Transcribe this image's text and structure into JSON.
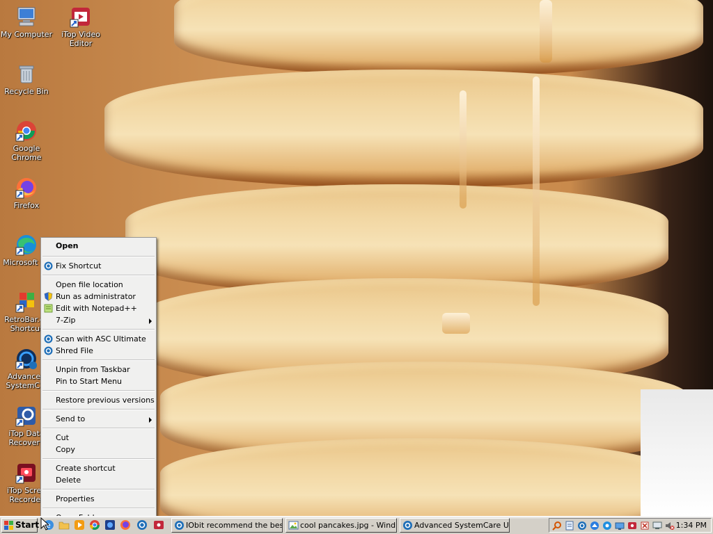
{
  "desktop": {
    "icons": [
      {
        "label": "My Computer"
      },
      {
        "label": "iTop Video Editor"
      },
      {
        "label": "Recycle Bin"
      },
      {
        "label": "Google Chrome"
      },
      {
        "label": "Firefox"
      },
      {
        "label": "Microsoft Ed"
      },
      {
        "label": "RetroBar.ex Shortcut"
      },
      {
        "label": "Advanced SystemC..."
      },
      {
        "label": "iTop Data Recovery"
      },
      {
        "label": "iTop Scree Recorder"
      }
    ]
  },
  "context_menu": {
    "items": [
      {
        "label": "Open"
      },
      {
        "label": "Fix Shortcut"
      },
      {
        "label": "Open file location"
      },
      {
        "label": "Run as administrator"
      },
      {
        "label": "Edit with Notepad++"
      },
      {
        "label": "7-Zip"
      },
      {
        "label": "Scan with ASC Ultimate"
      },
      {
        "label": "Shred File"
      },
      {
        "label": "Unpin from Taskbar"
      },
      {
        "label": "Pin to Start Menu"
      },
      {
        "label": "Restore previous versions"
      },
      {
        "label": "Send to"
      },
      {
        "label": "Cut"
      },
      {
        "label": "Copy"
      },
      {
        "label": "Create shortcut"
      },
      {
        "label": "Delete"
      },
      {
        "label": "Properties"
      },
      {
        "label": "Open Folder"
      }
    ]
  },
  "taskbar": {
    "start_label": "Start",
    "windows": [
      {
        "label": "IObit recommend the bes..."
      },
      {
        "label": "cool pancakes.jpg - Wind..."
      },
      {
        "label": "Advanced SystemCare Ul..."
      }
    ],
    "clock": "1:34 PM"
  },
  "colors": {
    "taskbar": "#d4d0c8",
    "menu_bg": "#f0f0ef",
    "asc_blue": "#1f6fb8"
  }
}
